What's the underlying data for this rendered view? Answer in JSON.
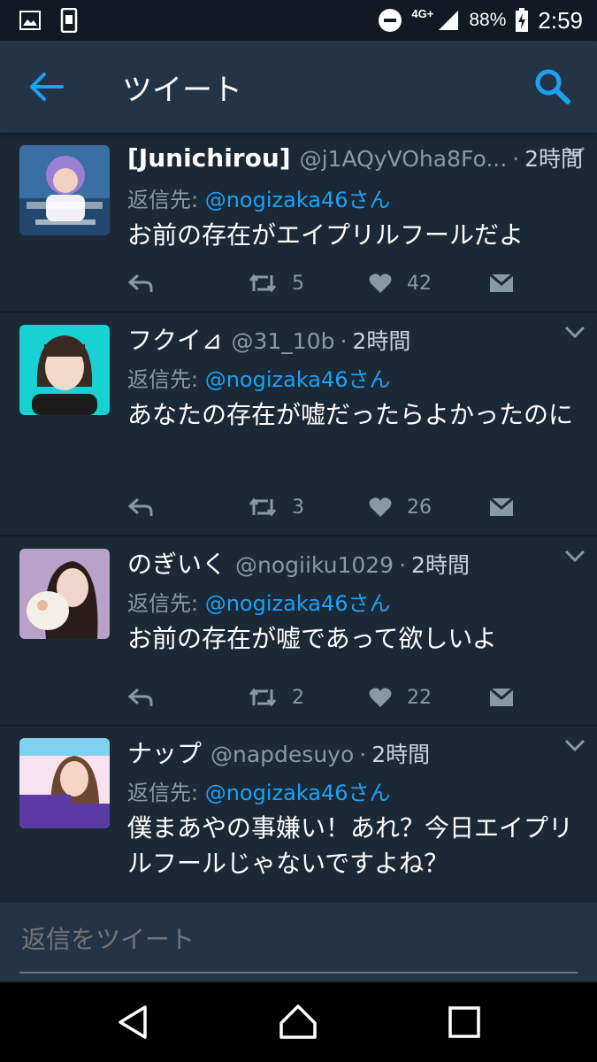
{
  "status_bar": {
    "left_icons": [
      "image-icon",
      "phone-notification-icon"
    ],
    "network": "4G+",
    "battery": "88%",
    "time": "2:59"
  },
  "app_bar": {
    "title": "ツイート",
    "back_icon": "arrow-left-icon",
    "search_icon": "search-icon"
  },
  "tweets": [
    {
      "display_name": "[Junichirou]",
      "handle": "@j1AQyVOha8Fo...",
      "time": "2時間",
      "reply_prefix": "返信先: ",
      "reply_to": "@nogizaka46さん",
      "text": "お前の存在がエイプリルフールだよ",
      "retweets": "5",
      "likes": "42"
    },
    {
      "display_name": "フクイ⊿",
      "handle": "@31_10b",
      "time": "2時間",
      "reply_prefix": "返信先: ",
      "reply_to": "@nogizaka46さん",
      "text": "あなたの存在が嘘だったらよかったのに",
      "retweets": "3",
      "likes": "26"
    },
    {
      "display_name": "のぎいく",
      "handle": "@nogiiku1029",
      "time": "2時間",
      "reply_prefix": "返信先: ",
      "reply_to": "@nogizaka46さん",
      "text": "お前の存在が嘘であって欲しいよ",
      "retweets": "2",
      "likes": "22"
    },
    {
      "display_name": "ナップ",
      "handle": "@napdesuyo",
      "time": "2時間",
      "reply_prefix": "返信先: ",
      "reply_to": "@nogizaka46さん",
      "text": "僕まあやの事嫌い！あれ？今日エイプリルフールじゃないですよね？",
      "retweets": "",
      "likes": ""
    }
  ],
  "composer": {
    "placeholder": "返信をツイート"
  },
  "colors": {
    "background": "#1b2836",
    "app_bar": "#243447",
    "accent": "#1da1f2",
    "muted": "#8899a6"
  }
}
